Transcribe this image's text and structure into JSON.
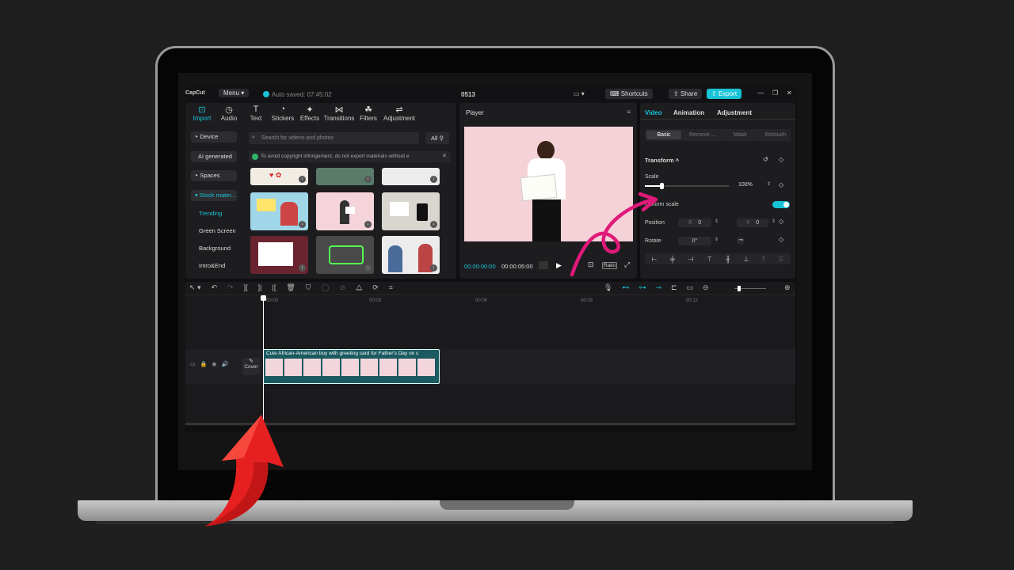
{
  "app": {
    "brand": "CapCut",
    "menu_label": "Menu",
    "autosave": "Auto saved: 07:45:02",
    "project_name": "0513",
    "shortcuts_label": "Shortcuts",
    "share_label": "Share",
    "export_label": "Export"
  },
  "tools": [
    {
      "label": "Import",
      "icon": "import-icon"
    },
    {
      "label": "Audio",
      "icon": "audio-icon"
    },
    {
      "label": "Text",
      "icon": "text-icon"
    },
    {
      "label": "Stickers",
      "icon": "stickers-icon"
    },
    {
      "label": "Effects",
      "icon": "effects-icon"
    },
    {
      "label": "Transitions",
      "icon": "transitions-icon"
    },
    {
      "label": "Filters",
      "icon": "filters-icon"
    },
    {
      "label": "Adjustment",
      "icon": "adjustment-icon"
    }
  ],
  "sidebar": {
    "items": [
      "Device",
      "AI generated",
      "Spaces",
      "Stock mater..."
    ],
    "sub_items": [
      "Trending",
      "Green Screen",
      "Background",
      "Intro&End"
    ]
  },
  "media": {
    "search_placeholder": "Search for videos and photos",
    "filter_label": "All",
    "notice": "To avoid copyright infringement, do not export materials without e"
  },
  "player": {
    "title": "Player",
    "current_time": "00:00:00:00",
    "duration": "00:00:05:00",
    "ratio_label": "Ratio"
  },
  "inspector": {
    "tabs": [
      "Video",
      "Animation",
      "Adjustment"
    ],
    "subtabs": [
      "Basic",
      "Remove ...",
      "Mask",
      "Retouch"
    ],
    "section_title": "Transform",
    "scale_label": "Scale",
    "scale_value": "100%",
    "scale_fraction": 0.2,
    "uniform_scale_label": "Uniform scale",
    "uniform_scale_on": true,
    "position_label": "Position",
    "x_label": "X",
    "x_value": "0",
    "y_label": "Y",
    "y_value": "0",
    "rotate_label": "Rotate",
    "rotate_value": "0°"
  },
  "timeline": {
    "ruler": [
      "00:00",
      "00:03",
      "00:06",
      "00:09",
      "00:12"
    ],
    "clip_title": "Cute African-American boy with greeting card for Father's Day on c",
    "cover_label": "Cover"
  },
  "colors": {
    "accent": "#18c3d6",
    "annotation_pink": "#e0197a",
    "annotation_red": "#e62020"
  }
}
